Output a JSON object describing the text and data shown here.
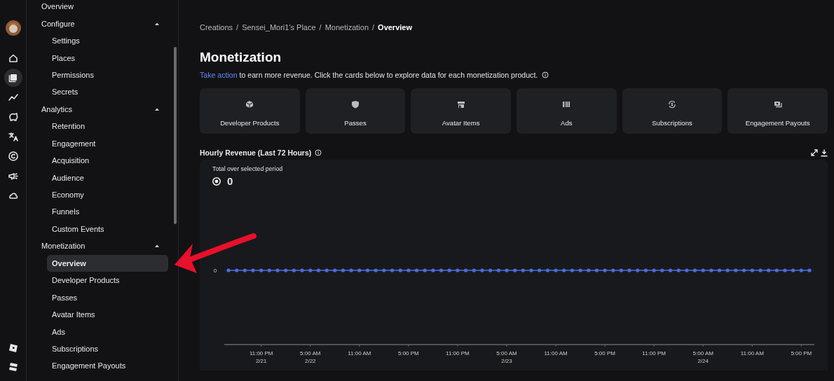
{
  "rail": {
    "items": [
      {
        "selected": false
      },
      {
        "selected": true
      },
      {
        "selected": false
      },
      {
        "selected": false
      },
      {
        "selected": false
      },
      {
        "selected": false
      },
      {
        "selected": false
      },
      {
        "selected": false
      }
    ]
  },
  "nav": {
    "top_item": {
      "label": "Overview",
      "selected": false
    },
    "sections": [
      {
        "label": "Configure",
        "expanded": true,
        "children": [
          {
            "label": "Settings",
            "selected": false
          },
          {
            "label": "Places",
            "selected": false
          },
          {
            "label": "Permissions",
            "selected": false
          },
          {
            "label": "Secrets",
            "selected": false
          }
        ]
      },
      {
        "label": "Analytics",
        "expanded": true,
        "children": [
          {
            "label": "Retention",
            "selected": false
          },
          {
            "label": "Engagement",
            "selected": false
          },
          {
            "label": "Acquisition",
            "selected": false
          },
          {
            "label": "Audience",
            "selected": false
          },
          {
            "label": "Economy",
            "selected": false
          },
          {
            "label": "Funnels",
            "selected": false
          },
          {
            "label": "Custom Events",
            "selected": false
          }
        ]
      },
      {
        "label": "Monetization",
        "expanded": true,
        "children": [
          {
            "label": "Overview",
            "selected": true
          },
          {
            "label": "Developer Products",
            "selected": false
          },
          {
            "label": "Passes",
            "selected": false
          },
          {
            "label": "Avatar Items",
            "selected": false
          },
          {
            "label": "Ads",
            "selected": false
          },
          {
            "label": "Subscriptions",
            "selected": false
          },
          {
            "label": "Engagement Payouts",
            "selected": false
          }
        ]
      }
    ]
  },
  "breadcrumb": [
    {
      "kind": "link",
      "label": "Creations"
    },
    {
      "kind": "separator",
      "label": "/"
    },
    {
      "kind": "link",
      "label": "Sensei_Mori1's Place"
    },
    {
      "kind": "separator",
      "label": "/"
    },
    {
      "kind": "link",
      "label": "Monetization"
    },
    {
      "kind": "separator",
      "label": "/"
    },
    {
      "kind": "current",
      "label": "Overview"
    }
  ],
  "page": {
    "title": "Monetization",
    "link": "Take action",
    "description": " to earn more revenue. Click the cards below to explore data for each monetization product."
  },
  "cards": [
    {
      "kind": "cube",
      "label": "Developer Products"
    },
    {
      "kind": "shield",
      "label": "Passes"
    },
    {
      "kind": "store",
      "label": "Avatar Items"
    },
    {
      "kind": "bars",
      "label": "Ads"
    },
    {
      "kind": "cycle",
      "label": "Subscriptions"
    },
    {
      "kind": "cash",
      "label": "Engagement Payouts"
    }
  ],
  "revenue": {
    "title": "Hourly Revenue (Last 72 Hours)",
    "total_label": "Total over selected period",
    "total": "0",
    "y_tick": "0",
    "x_labels": [
      {
        "time": "11:00 PM",
        "date": "2/21"
      },
      {
        "time": "5:00 AM",
        "date": "2/22"
      },
      {
        "time": "11:00 AM"
      },
      {
        "time": "5:00 PM"
      },
      {
        "time": "11:00 PM"
      },
      {
        "time": "5:00 AM",
        "date": "2/23"
      },
      {
        "time": "11:00 AM"
      },
      {
        "time": "5:00 PM"
      },
      {
        "time": "11:00 PM"
      },
      {
        "time": "5:00 AM",
        "date": "2/24"
      },
      {
        "time": "11:00 AM"
      },
      {
        "time": "5:00 PM"
      }
    ]
  }
}
